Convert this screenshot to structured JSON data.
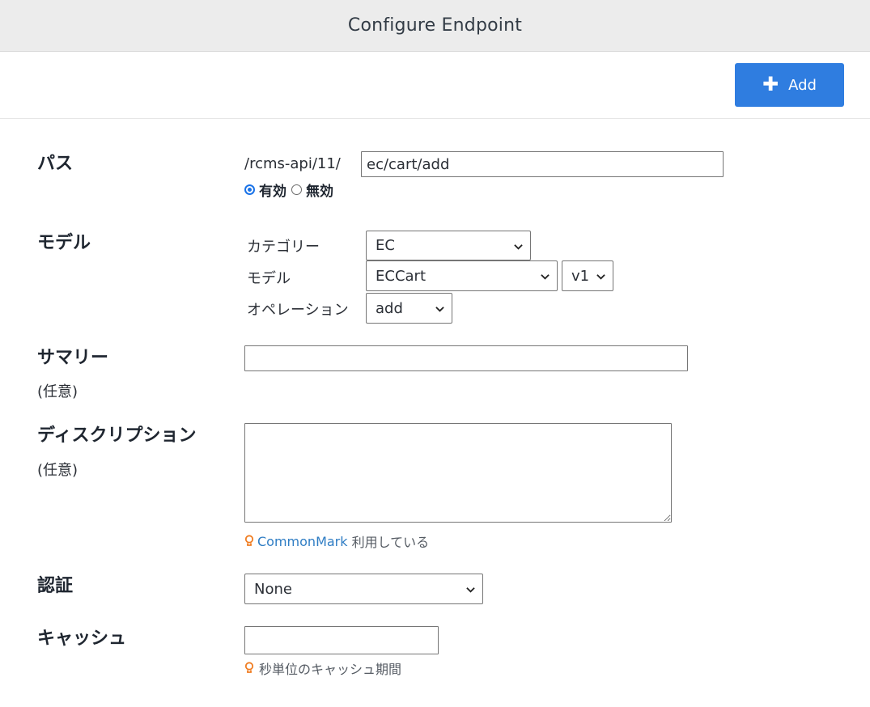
{
  "header": {
    "title": "Configure Endpoint"
  },
  "toolbar": {
    "add_label": "Add",
    "add_icon": "plus-icon"
  },
  "form": {
    "path": {
      "label": "パス",
      "prefix": "/rcms-api/11/",
      "value": "ec/cart/add",
      "options": [
        {
          "label": "有効",
          "selected": true
        },
        {
          "label": "無効",
          "selected": false
        }
      ]
    },
    "model": {
      "label": "モデル",
      "category_label": "カテゴリー",
      "category_value": "EC",
      "model_label": "モデル",
      "model_value": "ECCart",
      "version_value": "v1",
      "operation_label": "オペレーション",
      "operation_value": "add"
    },
    "summary": {
      "label": "サマリー",
      "optional": "(任意)",
      "value": ""
    },
    "description": {
      "label": "ディスクリプション",
      "optional": "(任意)",
      "value": "",
      "hint_link": "CommonMark",
      "hint_text": " 利用している"
    },
    "auth": {
      "label": "認証",
      "value": "None"
    },
    "cache": {
      "label": "キャッシュ",
      "value": "",
      "hint_text": "秒単位のキャッシュ期間"
    }
  },
  "colors": {
    "accent": "#2f7de0",
    "link": "#2f7dc4",
    "hint_icon": "#f07d22",
    "radio": "#1a73e8"
  }
}
